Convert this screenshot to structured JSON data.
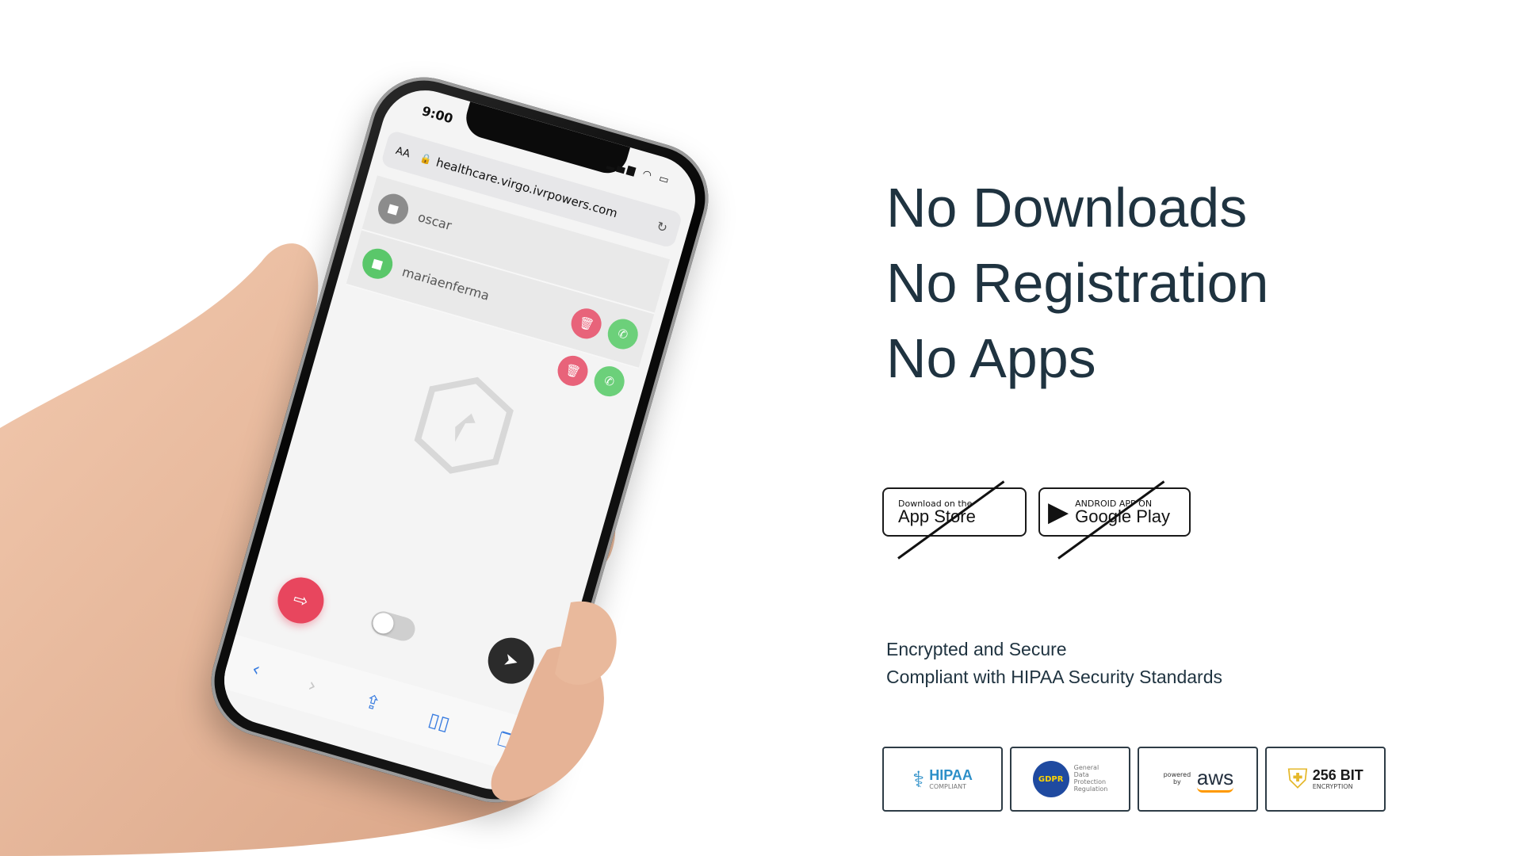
{
  "phone": {
    "status_time": "9:00",
    "url_aa": "AA",
    "url": "healthcare.virgo.ivrpowers.com",
    "contacts": [
      {
        "name": "oscar",
        "cam_color": "#8c8c8c"
      },
      {
        "name": "mariaenferma",
        "cam_color": "#5ac76a"
      }
    ],
    "delete_color": "#e8637a",
    "call_color": "#6cd07a"
  },
  "headline": {
    "line1": "No Downloads",
    "line2": "No Registration",
    "line3": "No Apps"
  },
  "stores": {
    "apple_small": "Download on the",
    "apple_big": "App Store",
    "google_small": "ANDROID APP ON",
    "google_big": "Google Play"
  },
  "security": {
    "line1": "Encrypted and Secure",
    "line2": "Compliant with HIPAA Security Standards"
  },
  "badges": {
    "hipaa_main": "HIPAA",
    "hipaa_sub": "COMPLIANT",
    "gdpr_main": "GDPR",
    "gdpr_sub_1": "General",
    "gdpr_sub_2": "Data",
    "gdpr_sub_3": "Protection",
    "gdpr_sub_4": "Regulation",
    "aws_small": "powered by",
    "aws_main": "aws",
    "ssl_main": "256 BIT",
    "ssl_sub": "ENCRYPTION"
  }
}
